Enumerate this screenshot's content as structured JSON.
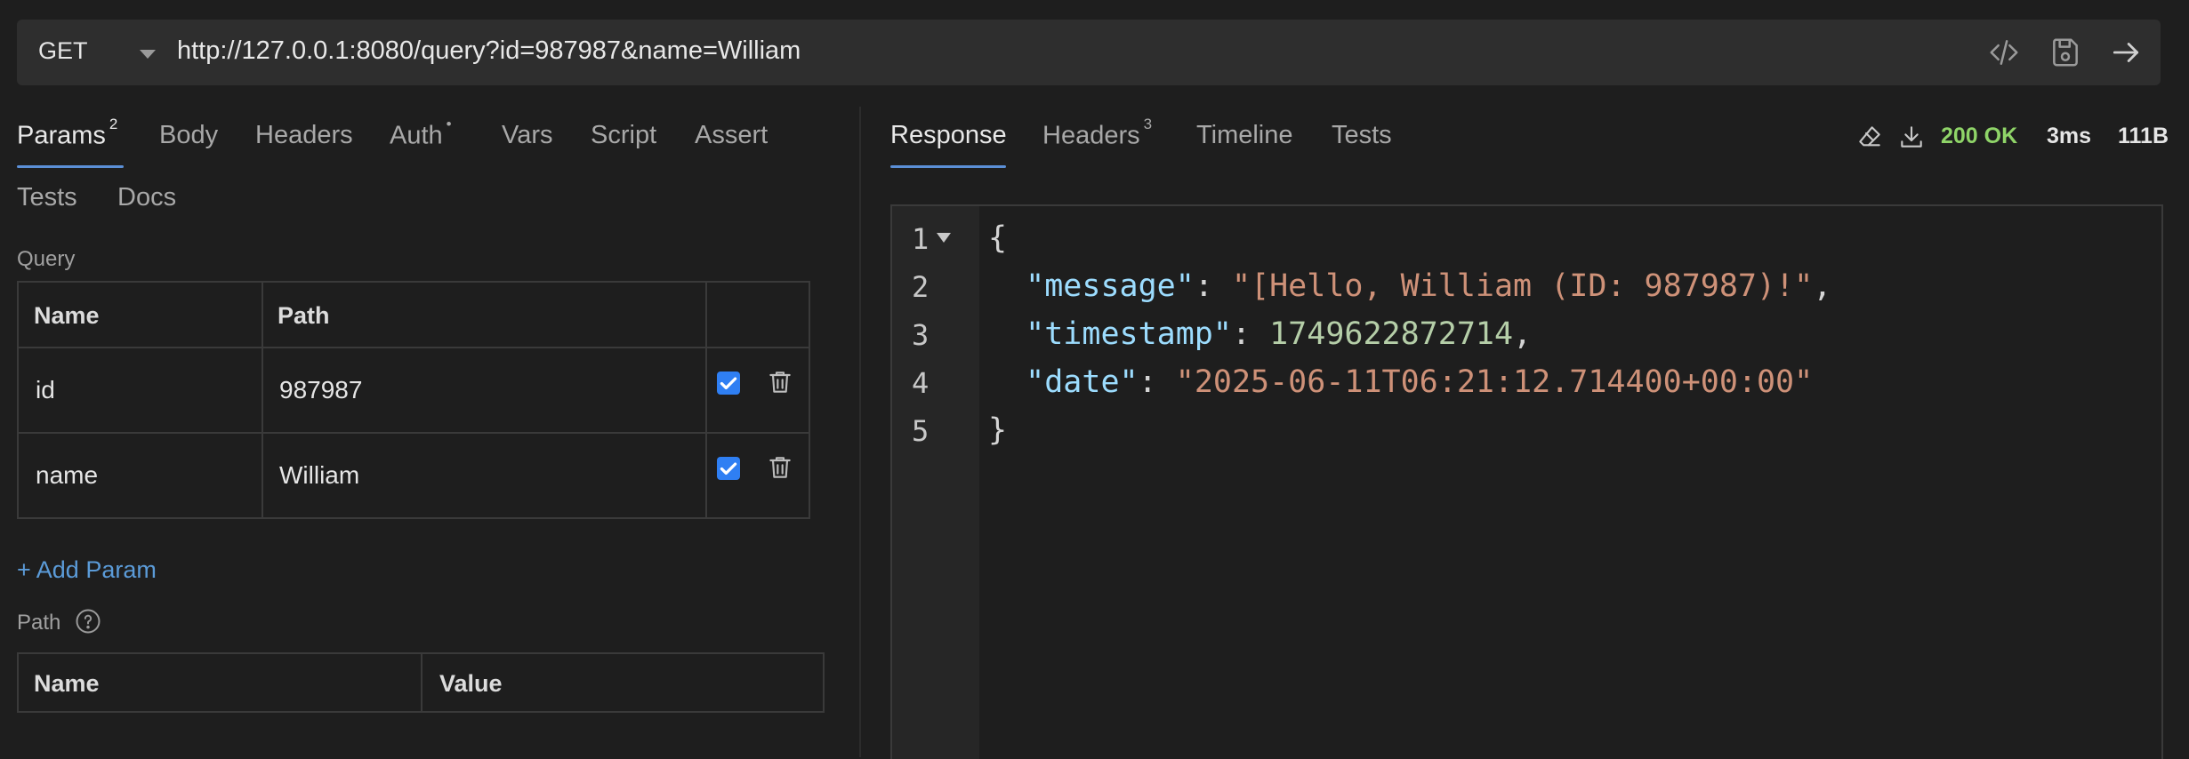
{
  "request": {
    "method": "GET",
    "url": "http://127.0.0.1:8080/query?id=987987&name=William"
  },
  "left_tabs": [
    {
      "label": "Params",
      "badge": "2"
    },
    {
      "label": "Body"
    },
    {
      "label": "Headers"
    },
    {
      "label": "Auth",
      "badge": "•"
    },
    {
      "label": "Vars"
    },
    {
      "label": "Script"
    },
    {
      "label": "Assert"
    },
    {
      "label": "Tests"
    },
    {
      "label": "Docs"
    }
  ],
  "query": {
    "section_label": "Query",
    "columns": [
      "Name",
      "Path"
    ],
    "rows": [
      {
        "name": "id",
        "value": "987987",
        "enabled": true
      },
      {
        "name": "name",
        "value": "William",
        "enabled": true
      }
    ],
    "add_label": "+ Add Param"
  },
  "path_params": {
    "section_label": "Path",
    "columns": [
      "Name",
      "Value"
    ]
  },
  "right_tabs": [
    {
      "label": "Response"
    },
    {
      "label": "Headers",
      "badge": "3"
    },
    {
      "label": "Timeline"
    },
    {
      "label": "Tests"
    }
  ],
  "response_meta": {
    "status": "200 OK",
    "status_color": "#8fd468",
    "time": "3ms",
    "size": "111B"
  },
  "response_body": {
    "line_numbers": [
      "1",
      "2",
      "3",
      "4",
      "5"
    ],
    "open_brace": "{",
    "close_brace": "}",
    "fields": [
      {
        "key": "\"message\"",
        "value": "\"[Hello, William (ID: 987987)!\"",
        "type": "string",
        "trailing": ","
      },
      {
        "key": "\"timestamp\"",
        "value": "1749622872714",
        "type": "number",
        "trailing": ","
      },
      {
        "key": "\"date\"",
        "value": "\"2025-06-11T06:21:12.714400+00:00\"",
        "type": "string",
        "trailing": ""
      }
    ]
  },
  "icons": {
    "generate_code": "code-icon",
    "save": "save-icon",
    "send": "arrow-right-icon",
    "clear": "eraser-icon",
    "download": "download-icon",
    "help": "question-icon",
    "delete": "trash-icon"
  }
}
